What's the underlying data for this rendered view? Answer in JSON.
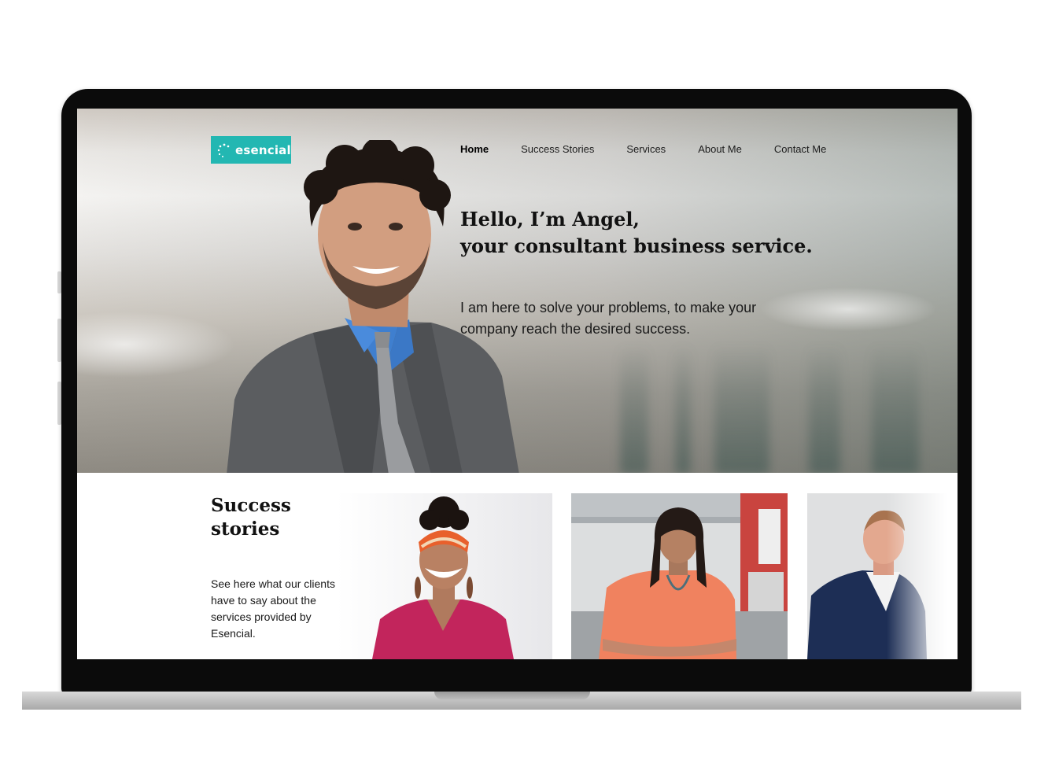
{
  "brand": {
    "name": "esencial",
    "color": "#23b7b2"
  },
  "nav": {
    "items": [
      {
        "label": "Home",
        "active": true
      },
      {
        "label": "Success Stories",
        "active": false
      },
      {
        "label": "Services",
        "active": false
      },
      {
        "label": "About Me",
        "active": false
      },
      {
        "label": "Contact Me",
        "active": false
      }
    ]
  },
  "hero": {
    "title_line1": "Hello, I’m Angel,",
    "title_line2": "your consultant business service.",
    "subtitle": "I am here to solve your problems, to make your company reach the desired success."
  },
  "stories": {
    "title_line1": "Success",
    "title_line2": "stories",
    "description": "See here what our clients have to say about the services provided by Esencial.",
    "cards": [
      {
        "name": "story-card-1"
      },
      {
        "name": "story-card-2"
      },
      {
        "name": "story-card-3"
      }
    ]
  }
}
